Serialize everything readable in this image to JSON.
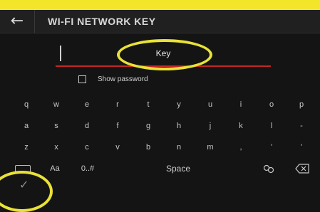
{
  "header": {
    "title": "WI-FI NETWORK KEY",
    "back_icon": "arrow-left-icon"
  },
  "input": {
    "placeholder": "Key"
  },
  "show_password": {
    "label": "Show password",
    "checked": false
  },
  "keyboard": {
    "row1": [
      "q",
      "w",
      "e",
      "r",
      "t",
      "y",
      "u",
      "i",
      "o",
      "p"
    ],
    "row2": [
      "a",
      "s",
      "d",
      "f",
      "g",
      "h",
      "j",
      "k",
      "l",
      "-"
    ],
    "row3": [
      "z",
      "x",
      "c",
      "v",
      "b",
      "n",
      "m",
      ",",
      "'",
      "'"
    ],
    "bottom": {
      "keyboard_icon": "keyboard-icon",
      "case_label": "Aa",
      "numbers_label": "0..#",
      "space_label": "Space",
      "special_icon": "special-chars-icon",
      "backspace_icon": "backspace-icon"
    }
  },
  "confirm": {
    "icon": "checkmark-icon"
  }
}
